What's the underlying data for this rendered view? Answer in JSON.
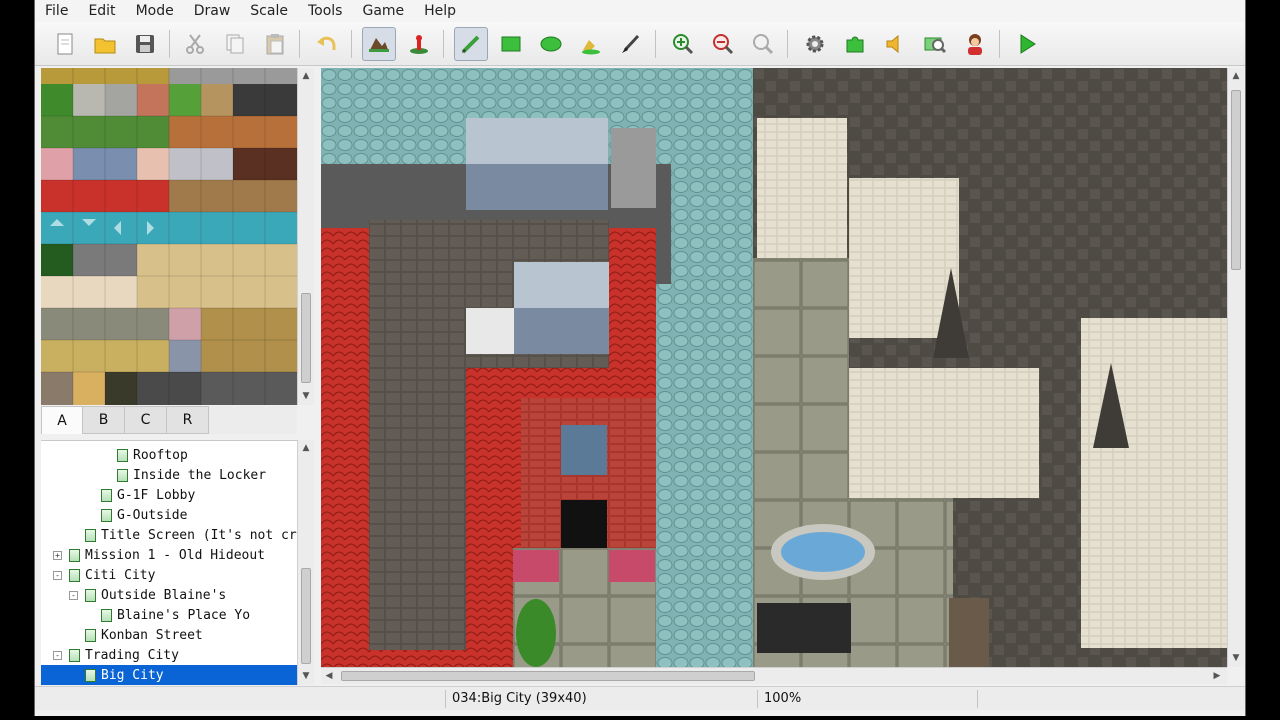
{
  "menu": [
    "File",
    "Edit",
    "Mode",
    "Draw",
    "Scale",
    "Tools",
    "Game",
    "Help"
  ],
  "toolbar": {
    "buttons": [
      {
        "name": "new-project-icon"
      },
      {
        "name": "open-project-icon"
      },
      {
        "name": "save-project-icon"
      },
      {
        "name": "cut-icon"
      },
      {
        "name": "copy-icon"
      },
      {
        "name": "paste-icon"
      },
      {
        "name": "undo-icon"
      },
      {
        "name": "map-layer-icon"
      },
      {
        "name": "event-layer-icon"
      },
      {
        "name": "pencil-icon"
      },
      {
        "name": "rectangle-icon"
      },
      {
        "name": "ellipse-icon"
      },
      {
        "name": "fill-icon"
      },
      {
        "name": "shadow-pen-icon"
      },
      {
        "name": "zoom-in-icon"
      },
      {
        "name": "zoom-out-icon"
      },
      {
        "name": "zoom-actual-icon"
      },
      {
        "name": "database-icon"
      },
      {
        "name": "plugin-manager-icon"
      },
      {
        "name": "sound-test-icon"
      },
      {
        "name": "event-searcher-icon"
      },
      {
        "name": "character-generator-icon"
      },
      {
        "name": "playtest-icon"
      }
    ]
  },
  "tileset_tabs": [
    "A",
    "B",
    "C",
    "R"
  ],
  "map_tree": [
    {
      "label": "Rooftop",
      "indent": 4,
      "expander": ""
    },
    {
      "label": "Inside the Locker",
      "indent": 4,
      "expander": ""
    },
    {
      "label": "G-1F Lobby",
      "indent": 3,
      "expander": ""
    },
    {
      "label": "G-Outside",
      "indent": 3,
      "expander": ""
    },
    {
      "label": "Title Screen (It's not creativ",
      "indent": 2,
      "expander": ""
    },
    {
      "label": "Mission 1 - Old Hideout",
      "indent": 1,
      "expander": "+"
    },
    {
      "label": "Citi City",
      "indent": 1,
      "expander": "-"
    },
    {
      "label": "Outside Blaine's",
      "indent": 2,
      "expander": "-"
    },
    {
      "label": "Blaine's Place Yo",
      "indent": 3,
      "expander": ""
    },
    {
      "label": "Konban Street",
      "indent": 2,
      "expander": ""
    },
    {
      "label": "Trading City",
      "indent": 1,
      "expander": "-"
    },
    {
      "label": "Big City",
      "indent": 2,
      "expander": "",
      "selected": true
    }
  ],
  "status": {
    "map": "034:Big City (39x40)",
    "zoom": "100%"
  },
  "colors": {
    "selection": "#0a64d6",
    "roof": "#c8322a",
    "water": "#7fb2b2",
    "stone": "#5c5650"
  }
}
